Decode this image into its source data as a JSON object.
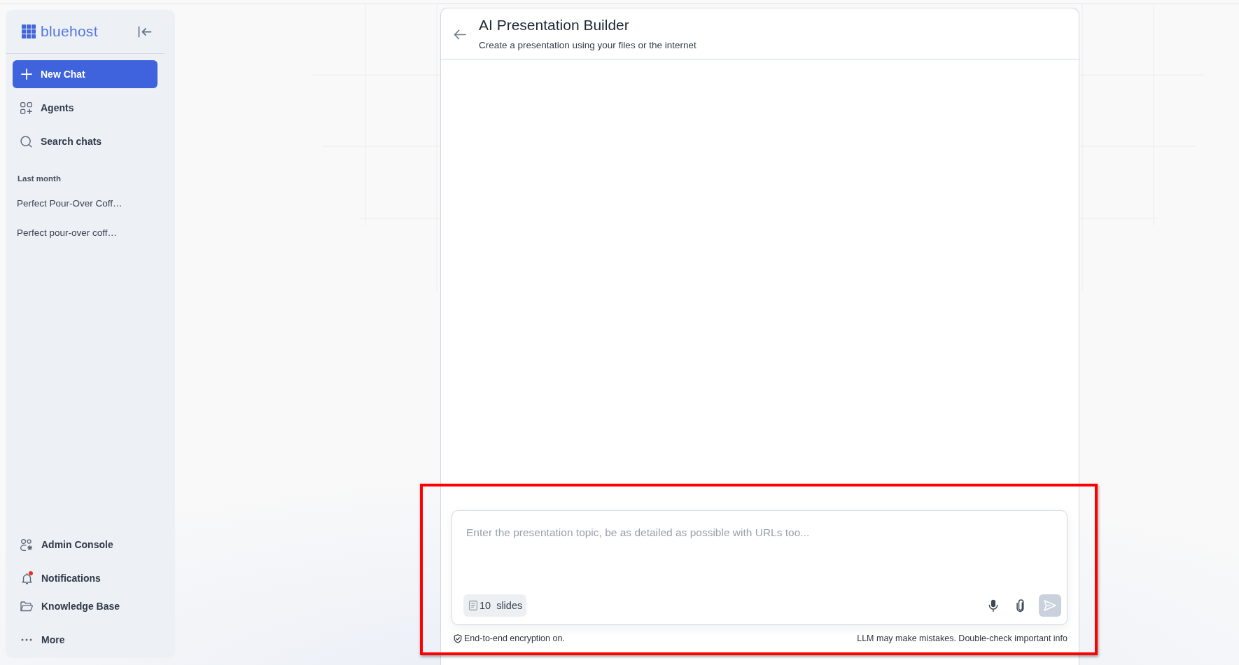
{
  "sidebar": {
    "logo": "bluehost",
    "new_chat": "New Chat",
    "nav": [
      {
        "label": "Agents"
      },
      {
        "label": "Search chats"
      }
    ],
    "section_label": "Last month",
    "history": [
      {
        "title": "Perfect Pour-Over Coff…",
        "selected": false
      },
      {
        "title": "Perfect pour-over coff…",
        "selected": false
      }
    ],
    "bottom_nav": [
      {
        "label": "Admin Console",
        "unread": false
      },
      {
        "label": "Notifications",
        "unread": true
      },
      {
        "label": "Knowledge Base",
        "unread": false
      },
      {
        "label": "More",
        "unread": false
      }
    ]
  },
  "header": {
    "title": "AI Presentation Builder",
    "subtitle": "Create a presentation using your files or the internet"
  },
  "composer": {
    "placeholder": "Enter the presentation topic, be as detailed as possible with URLs too...",
    "slides": {
      "count": "10",
      "label": "slides"
    },
    "send_disabled": true,
    "highlighted": true
  },
  "footer": {
    "encryption": "End-to-end encryption on.",
    "disclaimer": "LLM may make mistakes. Double-check important info"
  }
}
